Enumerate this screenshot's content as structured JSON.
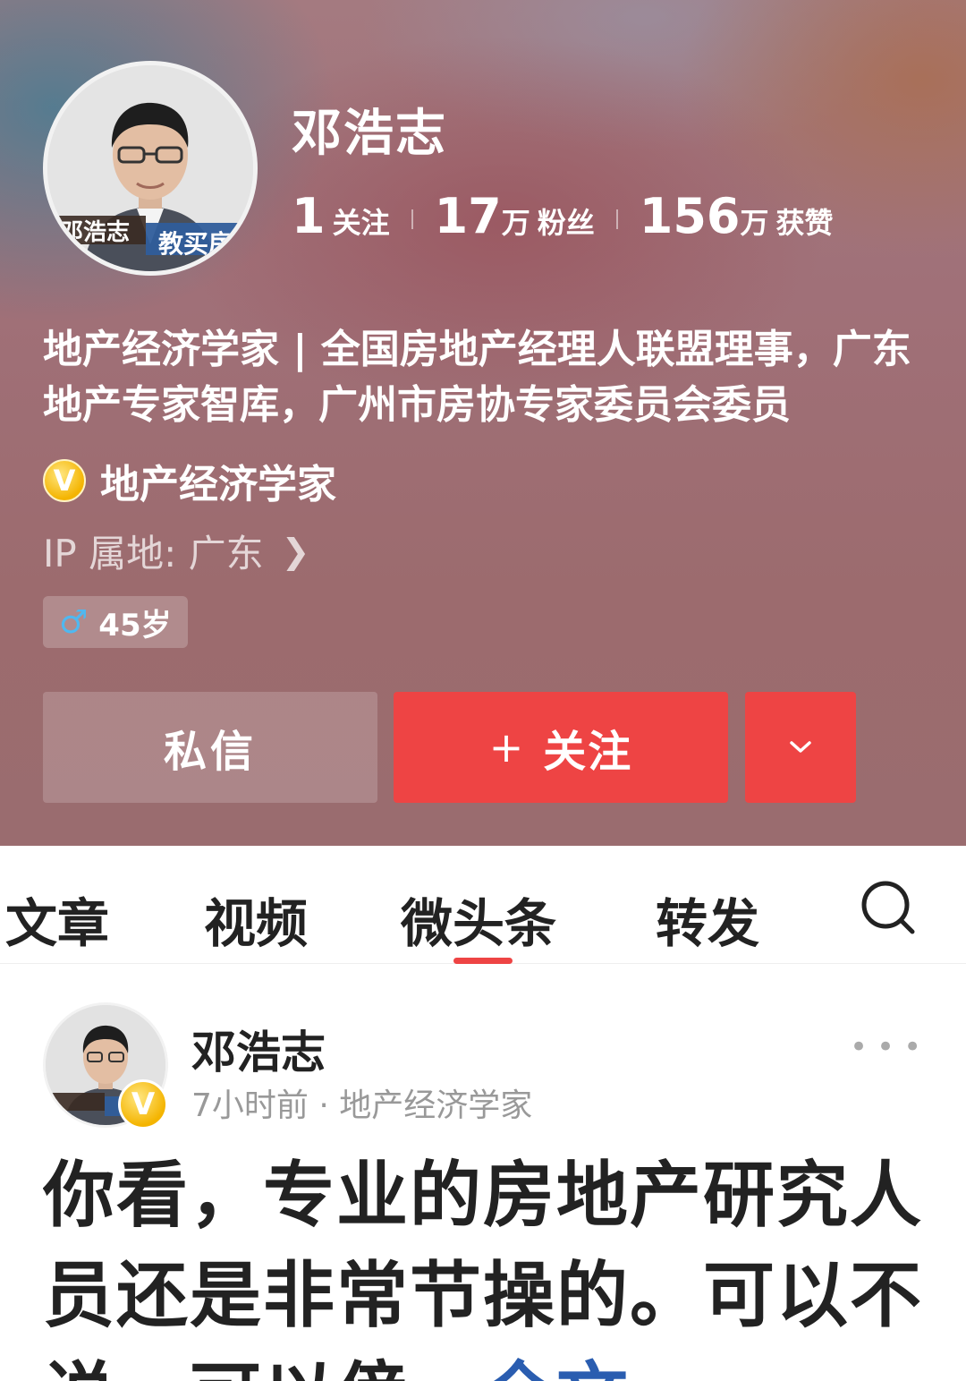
{
  "profile": {
    "name": "邓浩志",
    "avatar_caption": "邓浩志",
    "avatar_caption2": "教买房",
    "stats": [
      {
        "num": "1",
        "unit": "",
        "label": "关注"
      },
      {
        "num": "17",
        "unit": "万",
        "label": "粉丝"
      },
      {
        "num": "156",
        "unit": "万",
        "label": "获赞"
      }
    ],
    "bio": "地产经济学家 | 全国房地产经理人联盟理事，广东地产专家智库，广州市房协专家委员会委员",
    "verified_badge": "V",
    "verified_title": "地产经济学家",
    "ip_location": "IP 属地: 广东",
    "age": "45岁",
    "gender_icon": "male-icon"
  },
  "buttons": {
    "message": "私信",
    "follow_plus": "+",
    "follow": "关注",
    "more": "⌄"
  },
  "tabs": [
    "文章",
    "视频",
    "微头条",
    "转发"
  ],
  "active_tab": "微头条",
  "post": {
    "author": "邓浩志",
    "badge": "V",
    "meta": "7小时前 · 地产经济学家",
    "more": "•••",
    "text": "你看，专业的房地产研究人员还是非常节操的。可以不说，可以傍，",
    "full_link": "全文"
  },
  "colors": {
    "accent_red": "#ee4444",
    "link_blue": "#2a5db0",
    "verified_gold": "#f4b400"
  }
}
